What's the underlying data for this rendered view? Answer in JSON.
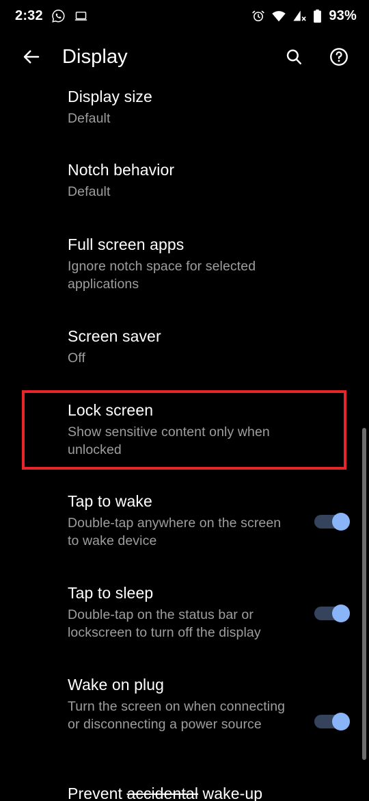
{
  "status_bar": {
    "time": "2:32",
    "battery_percent": "93%",
    "left_icons": [
      "whatsapp-icon",
      "laptop-icon"
    ],
    "right_icons": [
      "alarm-icon",
      "wifi-icon",
      "cellular-signal-off-icon",
      "battery-icon"
    ]
  },
  "app_bar": {
    "back_label": "back-arrow",
    "title": "Display",
    "search_label": "search",
    "help_label": "help"
  },
  "settings": [
    {
      "title": "Display size",
      "summary": "Default",
      "has_switch": false
    },
    {
      "title": "Notch behavior",
      "summary": "Default",
      "has_switch": false
    },
    {
      "title": "Full screen apps",
      "summary": "Ignore notch space for selected applications",
      "has_switch": false
    },
    {
      "title": "Screen saver",
      "summary": "Off",
      "has_switch": false
    },
    {
      "title": "Lock screen",
      "summary": "Show sensitive content only when unlocked",
      "has_switch": false,
      "highlighted": true
    },
    {
      "title": "Tap to wake",
      "summary": "Double-tap anywhere on the screen to wake device",
      "has_switch": true,
      "switch_on": true
    },
    {
      "title": "Tap to sleep",
      "summary": "Double-tap on the status bar or lockscreen to turn off the display",
      "has_switch": true,
      "switch_on": true
    },
    {
      "title": "Wake on plug",
      "summary": "Turn the screen on when connecting or disconnecting a power source",
      "has_switch": true,
      "switch_on": true
    },
    {
      "title": "Prevent accidental wake-up",
      "title_prefix": "Prevent ",
      "title_struck": "accidental",
      "title_suffix": " wake-up",
      "summary": "",
      "has_switch": false,
      "clipped": true
    }
  ],
  "colors": {
    "background": "#000000",
    "title_text": "#ffffff",
    "summary_text": "#9e9e9e",
    "highlight_border": "#e8252b",
    "switch_thumb_on": "#8ab4f8",
    "switch_track_on": "#36435c",
    "scrollbar": "#6e6e6e"
  }
}
